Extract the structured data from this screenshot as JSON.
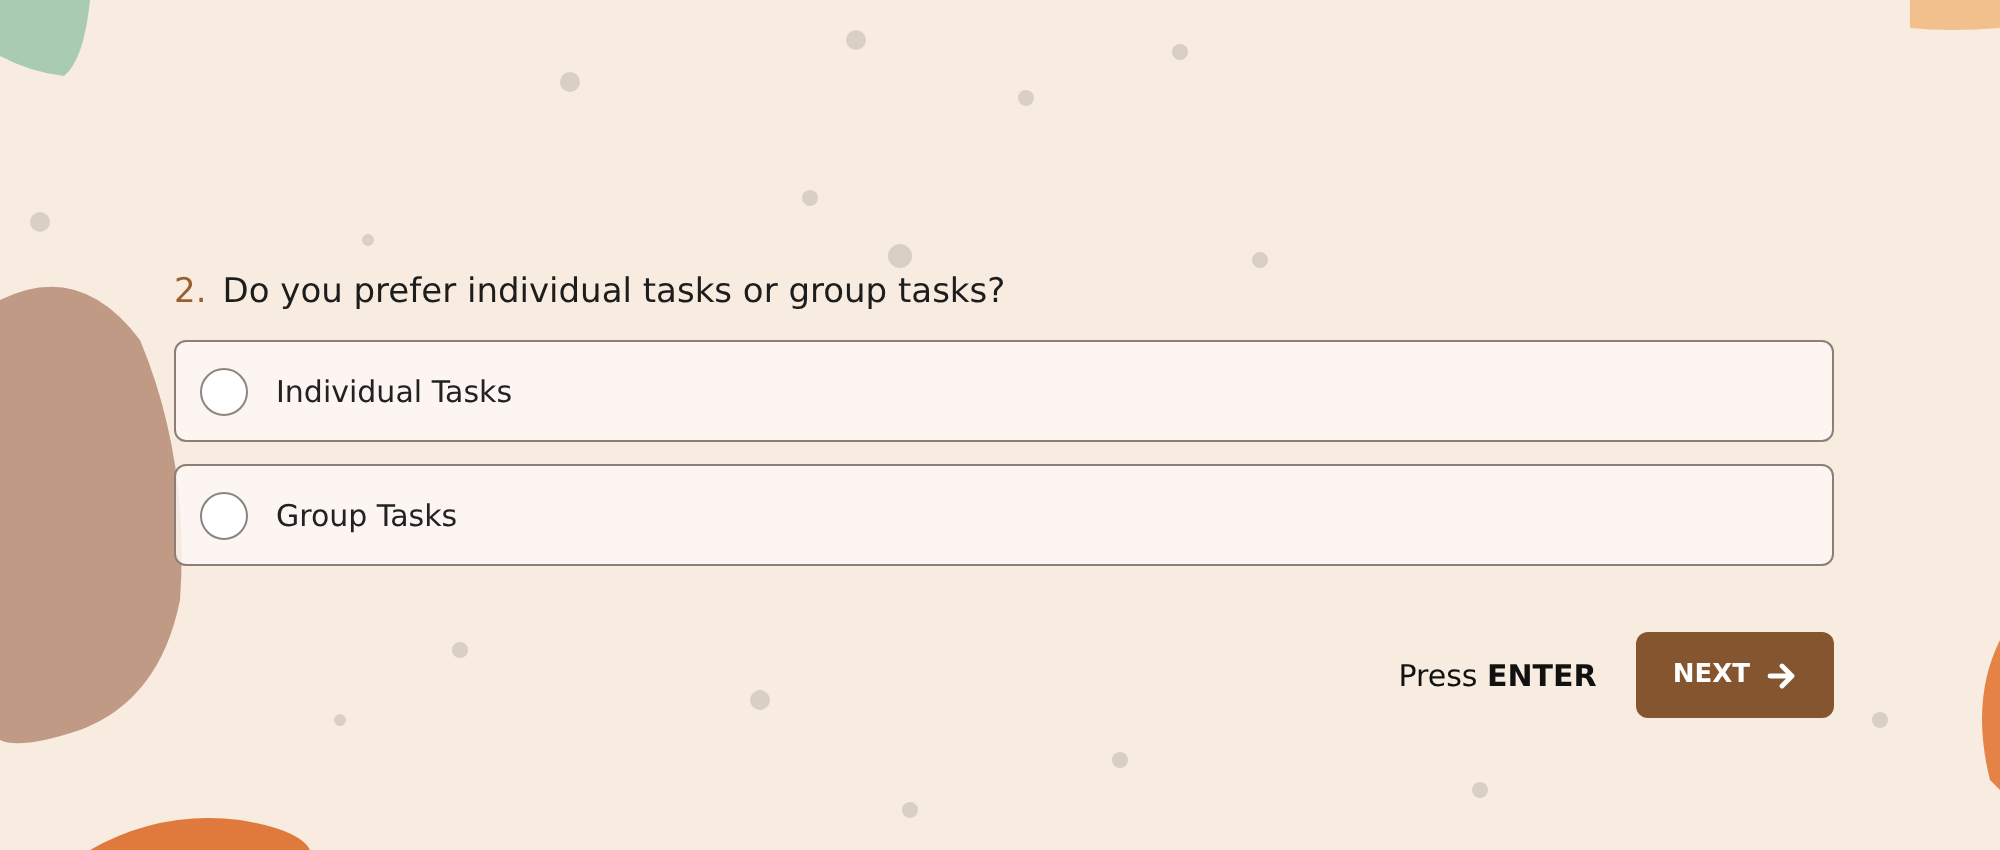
{
  "question": {
    "number": "2.",
    "text": "Do you prefer individual tasks or group tasks?"
  },
  "options": [
    {
      "label": "Individual Tasks",
      "selected": false
    },
    {
      "label": "Group Tasks",
      "selected": false
    }
  ],
  "hint": "Press **ENTER**",
  "next_button": {
    "label": "NEXT"
  }
}
